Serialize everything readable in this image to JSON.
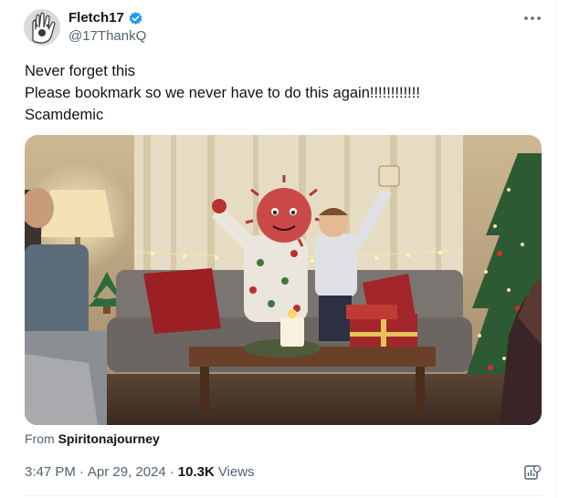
{
  "author": {
    "display_name": "Fletch17",
    "handle": "@17ThankQ",
    "verified": true,
    "verified_color": "#1d9bf0"
  },
  "more_icon": "more-horizontal-icon",
  "tweet": {
    "lines": [
      "Never forget this",
      "Please bookmark so we never have to do this again!!!!!!!!!!!!",
      "Scamdemic"
    ]
  },
  "media": {
    "kind": "video-still",
    "scene": "holiday living room"
  },
  "attribution": {
    "prefix": "From",
    "source": "Spiritonajourney"
  },
  "meta": {
    "time": "3:47 PM",
    "separator": "·",
    "date": "Apr 29, 2024",
    "views_count": "10.3K",
    "views_label": "Views"
  },
  "analytics_icon": "analytics-icon",
  "colors": {
    "text_primary": "#0f1419",
    "text_secondary": "#536471",
    "divider": "#eff3f4"
  }
}
